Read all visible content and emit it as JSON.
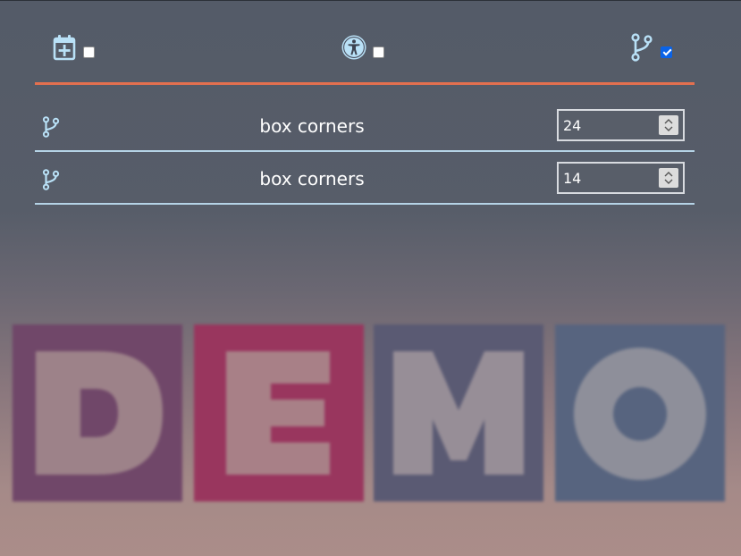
{
  "toolbar": {
    "items": [
      {
        "icon": "calendar-plus-icon",
        "checked": false
      },
      {
        "icon": "accessibility-icon",
        "checked": false
      },
      {
        "icon": "git-branch-icon",
        "checked": true
      }
    ],
    "divider_color": "#e3704f"
  },
  "rows": [
    {
      "icon": "git-branch-icon",
      "label": "box corners",
      "value": "24"
    },
    {
      "icon": "git-branch-icon",
      "label": "box corners",
      "value": "14"
    }
  ],
  "colors": {
    "icon": "#b9e1f7",
    "row_divider": "#b5d3e6",
    "checkbox_checked": "#0a63e8"
  },
  "background": {
    "watermark_text": "DEMO",
    "letters": [
      "D",
      "E",
      "M",
      "O"
    ]
  }
}
